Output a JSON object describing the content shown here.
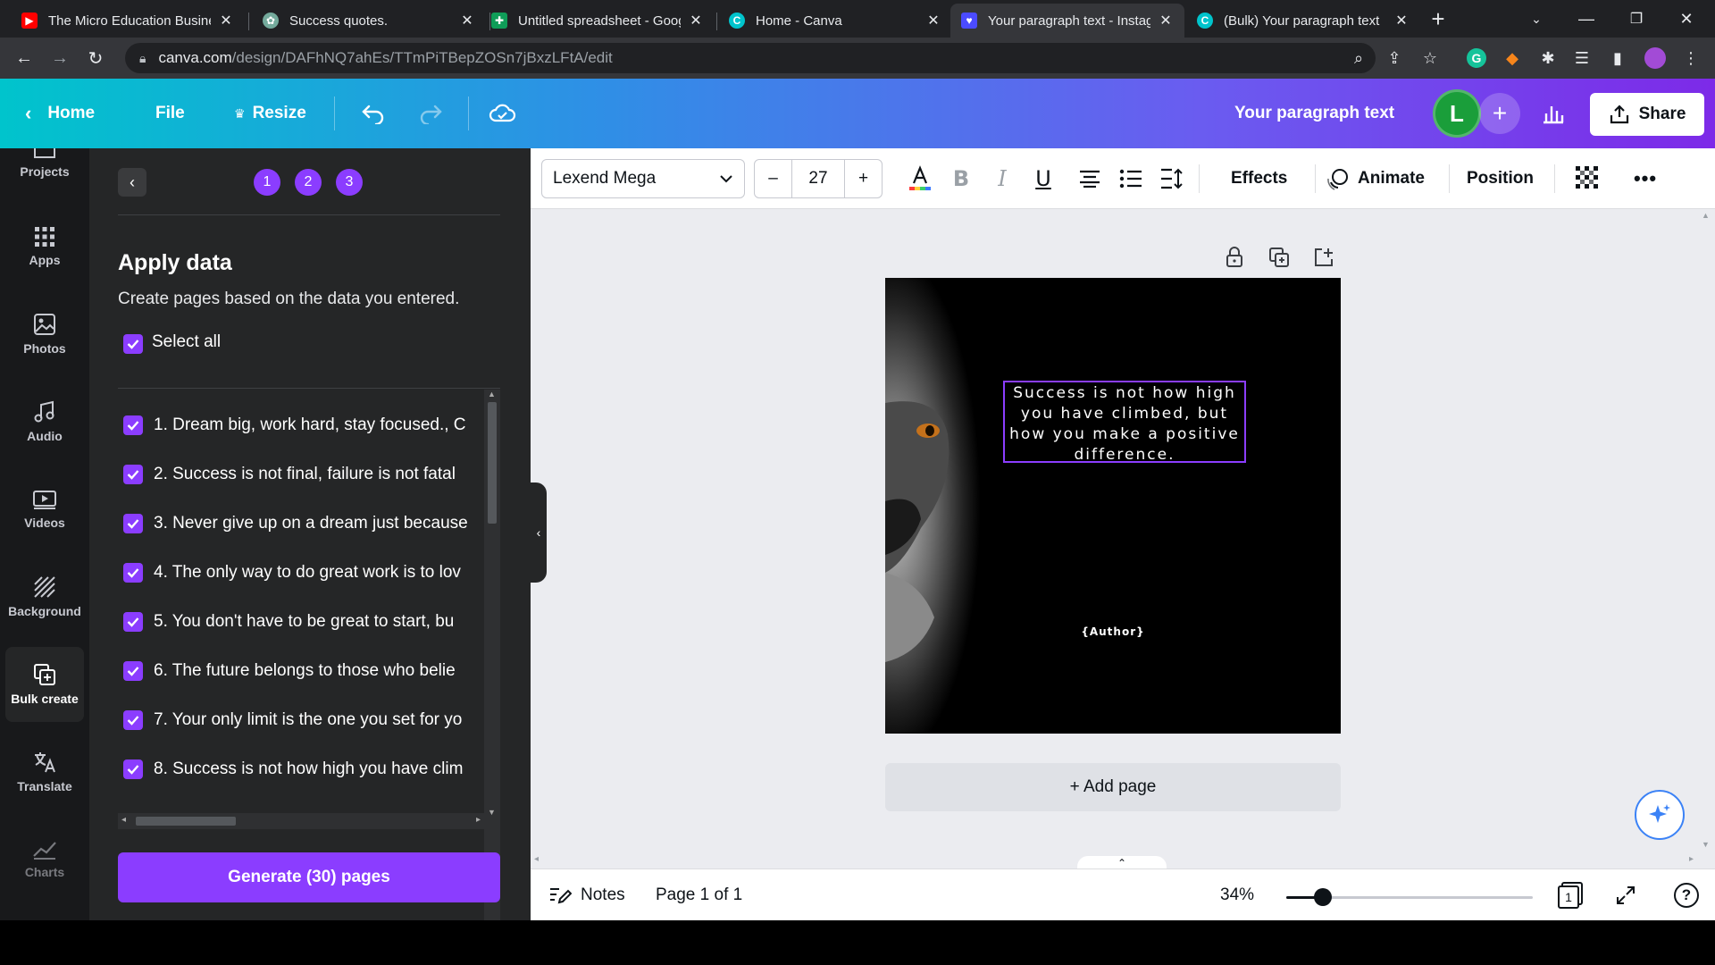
{
  "browser": {
    "tabs": [
      {
        "title": "The Micro Education Business",
        "icon": "youtube-icon",
        "color": "#ff0000"
      },
      {
        "title": "Success quotes.",
        "icon": "openai-icon",
        "color": "#74aa9c"
      },
      {
        "title": "Untitled spreadsheet - Google Sheets",
        "icon": "sheets-icon",
        "color": "#0f9d58"
      },
      {
        "title": "Home - Canva",
        "icon": "canva-icon",
        "color": "#00c4cc"
      },
      {
        "title": "Your paragraph text - Instagram",
        "icon": "canva-heart-icon",
        "color": "#4b4bff"
      },
      {
        "title": "(Bulk) Your paragraph text",
        "icon": "canva-icon",
        "color": "#00c4cc"
      }
    ],
    "url_host": "canva.com",
    "url_path": "/design/DAFhNQ7ahEs/TTmPiTBepZOSn7jBxzLFtA/edit"
  },
  "canva_bar": {
    "home": "Home",
    "file": "File",
    "resize": "Resize",
    "design_title": "Your paragraph text",
    "avatar_letter": "L",
    "share": "Share"
  },
  "rail": [
    {
      "label": "Projects",
      "icon": "folder-icon"
    },
    {
      "label": "Apps",
      "icon": "apps-grid-icon"
    },
    {
      "label": "Photos",
      "icon": "photo-icon"
    },
    {
      "label": "Audio",
      "icon": "music-note-icon"
    },
    {
      "label": "Videos",
      "icon": "video-icon"
    },
    {
      "label": "Background",
      "icon": "background-pattern-icon"
    },
    {
      "label": "Bulk create",
      "icon": "bulk-create-icon"
    },
    {
      "label": "Translate",
      "icon": "translate-icon"
    },
    {
      "label": "Charts",
      "icon": "chart-line-icon"
    }
  ],
  "panel": {
    "steps": [
      "1",
      "2",
      "3"
    ],
    "title": "Apply data",
    "subtitle": "Create pages based on the data you entered.",
    "select_all": "Select all",
    "items": [
      "1. Dream big, work hard, stay focused., C",
      "2. Success is not final, failure is not fatal",
      "3. Never give up on a dream just because",
      "4. The only way to do great work is to lov",
      "5. You don't have to be great to start, bu",
      "6. The future belongs to those who belie",
      "7. Your only limit is the one you set for yo",
      "8. Success is not how high you have clim"
    ],
    "generate": "Generate (30) pages"
  },
  "toolbar": {
    "font": "Lexend Mega",
    "size": "27",
    "effects": "Effects",
    "animate": "Animate",
    "position": "Position",
    "text_color": "#ff3b3b"
  },
  "canvas": {
    "quote": "Success is not how high you have climbed, but how you make a positive difference.",
    "author": "{Author}",
    "add_page": "+ Add page"
  },
  "bottom": {
    "notes": "Notes",
    "page_indicator": "Page 1 of 1",
    "zoom": "34%",
    "zoom_fraction": 0.34,
    "page_count": "1"
  }
}
